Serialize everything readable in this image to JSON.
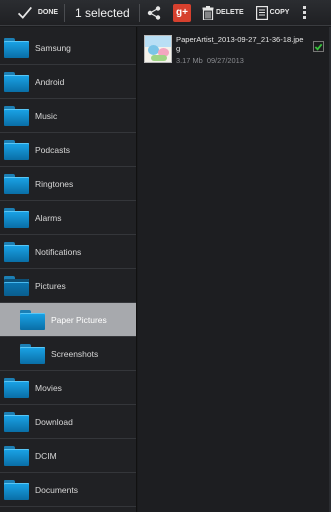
{
  "action_bar": {
    "done_label": "DONE",
    "selected_count": "1 selected",
    "share_icon": "share-icon",
    "gplus_text": "g+",
    "delete_label": "DELETE",
    "copy_label": "COPY",
    "overflow_icon": "overflow-menu-icon"
  },
  "folders": [
    {
      "label": "Samsung",
      "state": "normal"
    },
    {
      "label": "Android",
      "state": "normal"
    },
    {
      "label": "Music",
      "state": "normal"
    },
    {
      "label": "Podcasts",
      "state": "normal"
    },
    {
      "label": "Ringtones",
      "state": "normal"
    },
    {
      "label": "Alarms",
      "state": "normal"
    },
    {
      "label": "Notifications",
      "state": "normal"
    },
    {
      "label": "Pictures",
      "state": "open"
    },
    {
      "label": "Paper Pictures",
      "state": "selected"
    },
    {
      "label": "Screenshots",
      "state": "normal"
    },
    {
      "label": "Movies",
      "state": "normal"
    },
    {
      "label": "Download",
      "state": "normal"
    },
    {
      "label": "DCIM",
      "state": "normal"
    },
    {
      "label": "Documents",
      "state": "normal"
    }
  ],
  "files": [
    {
      "name": "PaperArtist_2013-09-27_21-36-18.jpeg",
      "size": "3.17 Mb",
      "date": "09/27/2013",
      "checked": true
    }
  ],
  "colors": {
    "folder_blue": "#1aa4e8",
    "selected_row": "#a7a9ad",
    "check_green": "#37c13b"
  }
}
